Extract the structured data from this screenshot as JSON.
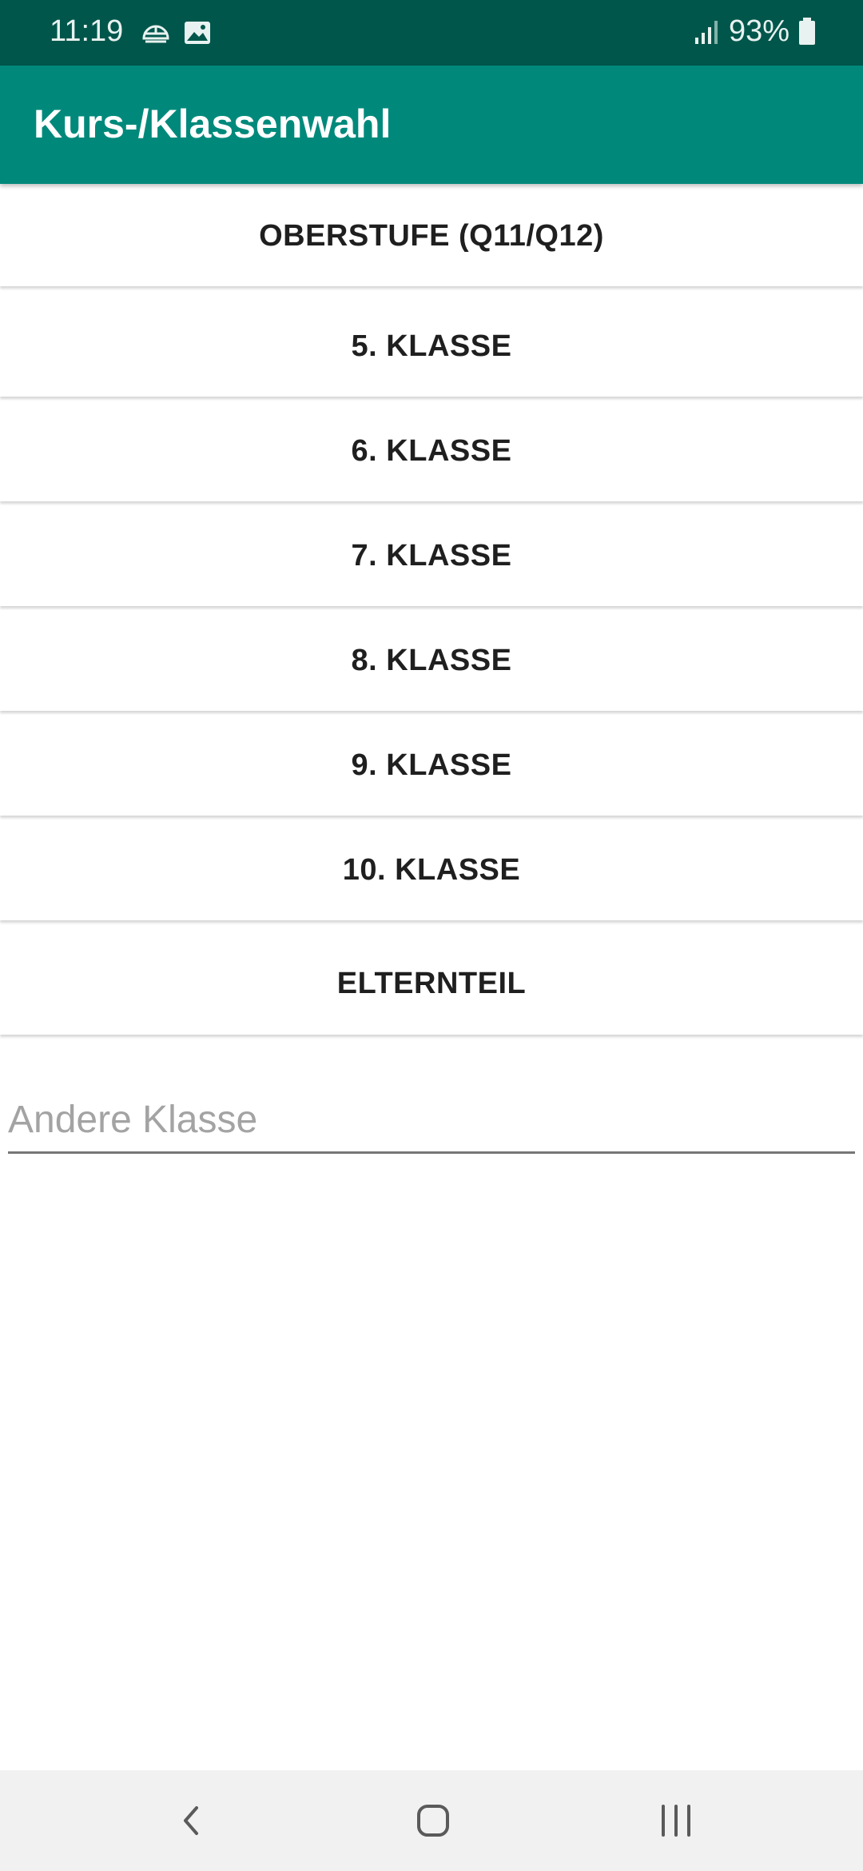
{
  "status_bar": {
    "time": "11:19",
    "left_icons": [
      "cloud-sync-icon",
      "gallery-icon"
    ],
    "battery_text": "93%",
    "signal_icon": "signal-icon",
    "battery_icon": "battery-icon"
  },
  "app_bar": {
    "title": "Kurs-/Klassenwahl"
  },
  "options": [
    "OBERSTUFE (Q11/Q12)",
    "5. KLASSE",
    "6. KLASSE",
    "7. KLASSE",
    "8. KLASSE",
    "9. KLASSE",
    "10. KLASSE",
    "ELTERNTEIL"
  ],
  "other_class": {
    "placeholder": "Andere Klasse",
    "value": ""
  },
  "nav_bar": {
    "icons": [
      "back-icon",
      "home-icon",
      "recents-icon"
    ]
  },
  "colors": {
    "status_bar": "#00564b",
    "app_bar": "#00897b",
    "nav_bar": "#f1f1f1"
  }
}
